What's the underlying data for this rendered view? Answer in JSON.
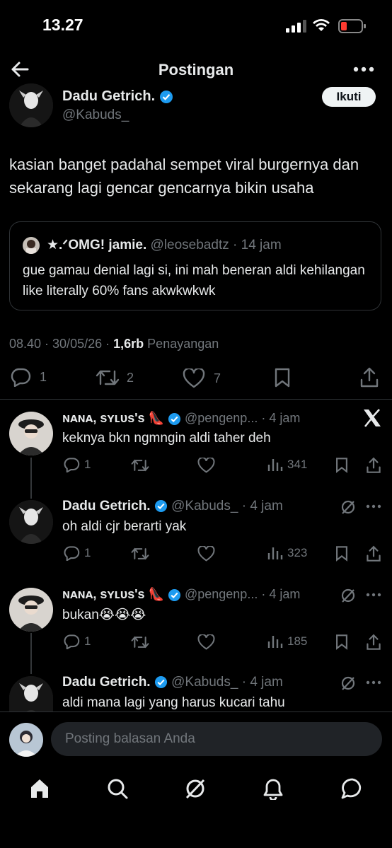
{
  "status_bar": {
    "time": "13.27"
  },
  "header": {
    "title": "Postingan"
  },
  "post": {
    "author_name": "Dadu Getrich.",
    "author_handle": "@Kabuds_",
    "follow_label": "Ikuti",
    "text": "kasian banget padahal sempet viral burgernya dan sekarang lagi gencar gencarnya bikin usaha",
    "quote": {
      "name": "★.ᐟOMG! jamie.",
      "handle": "@leosebadtz",
      "time": "· 14 jam",
      "text": "gue gamau denial lagi si, ini mah beneran aldi kehilangan like literally 60% fans akwkwkwk"
    },
    "timestamp": "08.40 · 30/05/26 ·",
    "views_count": "1,6rb",
    "views_label": "Penayangan",
    "stats": {
      "replies": "1",
      "reposts": "2",
      "likes": "7"
    }
  },
  "replies": [
    {
      "name": "ɴᴀɴᴀ, sʏʟᴜs's 👠",
      "handle": "@pengenp...",
      "time": "· 4 jam",
      "text": "keknya bkn ngmngin aldi taher deh",
      "replies": "1",
      "views": "341"
    },
    {
      "name": "Dadu Getrich.",
      "handle": "@Kabuds_",
      "time": "· 4 jam",
      "text": "oh aldi cjr berarti yak",
      "replies": "1",
      "views": "323"
    },
    {
      "name": "ɴᴀɴᴀ, sʏʟᴜs's 👠",
      "handle": "@pengenp...",
      "time": "· 4 jam",
      "text": "bukan😭😭😭",
      "replies": "1",
      "views": "185"
    },
    {
      "name": "Dadu Getrich.",
      "handle": "@Kabuds_",
      "time": "· 4 jam",
      "text": "aldi mana lagi yang harus kucari tahu"
    }
  ],
  "composer": {
    "placeholder": "Posting balasan Anda"
  },
  "bottom_nav": [
    "home-icon",
    "search-icon",
    "grok-icon",
    "notifications-icon",
    "messages-icon"
  ],
  "colors": {
    "background": "#000000",
    "text": "#e7e9ea",
    "muted": "#71767b",
    "verified": "#1d9bf0",
    "battery_low": "#ff3b30"
  }
}
